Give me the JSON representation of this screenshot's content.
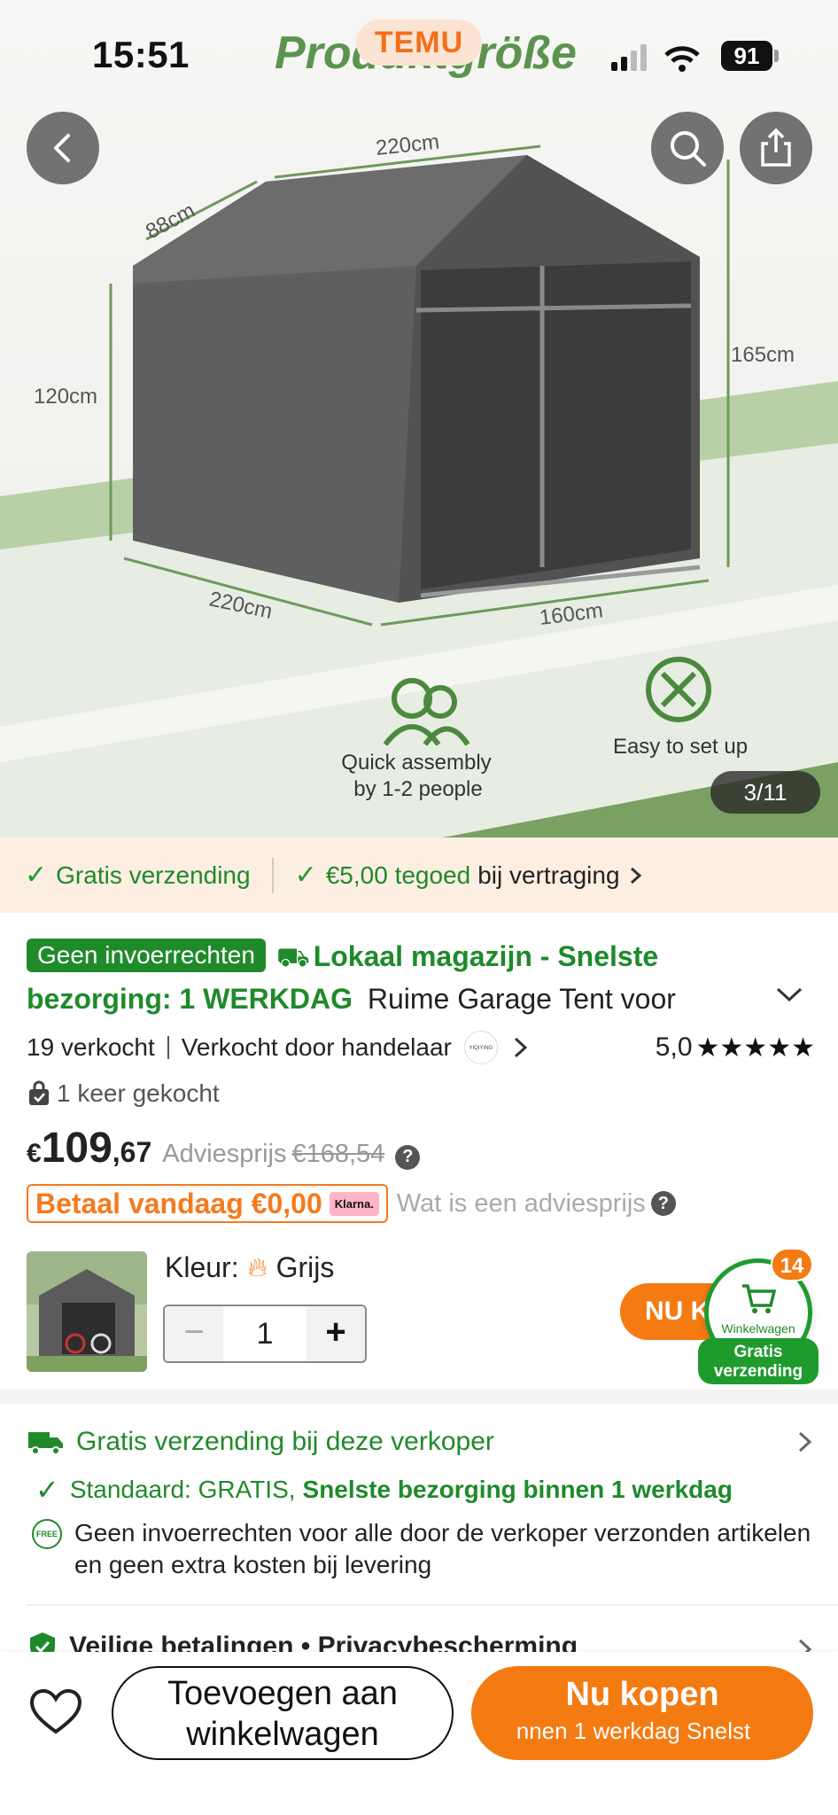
{
  "status": {
    "time": "15:51",
    "battery": "91"
  },
  "hero": {
    "brand": "TEMU",
    "heading": "Produktgröße",
    "dims": {
      "width_top": "220cm",
      "depth": "88cm",
      "side_height": "120cm",
      "height": "165cm",
      "base_left": "220cm",
      "base_front": "160cm"
    },
    "feature1_line1": "Quick assembly",
    "feature1_line2": "by 1-2 people",
    "feature2": "Easy to set up",
    "counter": "3/11"
  },
  "banner": {
    "free_shipping": "Gratis verzending",
    "credit_amount": "€5,00 tegoed",
    "credit_suffix": "bij vertraging"
  },
  "product": {
    "badge": "Geen invoerrechten",
    "title_green": "Lokaal magazijn - Snelste bezorging: 1 WERKDAG",
    "title": "Ruime Garage Tent voor",
    "sold": "19 verkocht",
    "seller": "Verkocht door handelaar",
    "seller_logo": "YIQIYING CO LTD",
    "rating": "5,0",
    "stars": "★★★★★",
    "bought": "1 keer gekocht",
    "currency": "€",
    "price_main": "109",
    "price_cents": ",67",
    "advies_label": "Adviesprijs",
    "advies_price": "€168,54",
    "pay_today": "Betaal vandaag €0,00",
    "klarna": "Klarna.",
    "advies_question": "Wat is een adviesprijs",
    "color_label": "Kleur:",
    "color_value": "Grijs",
    "quantity": "1"
  },
  "cart_float": {
    "buy_small": "NU K",
    "label": "Winkelwagen",
    "count": "14",
    "gratis_line1": "Gratis",
    "gratis_line2": "verzending"
  },
  "shipping": {
    "heading": "Gratis verzending bij deze verkoper",
    "standard_prefix": "Standaard: GRATIS,",
    "standard_bold": "Snelste bezorging binnen 1 werkdag",
    "free_icon": "FREE",
    "no_duties": "Geen invoerrechten voor alle door de verkoper verzonden artikelen en geen extra kosten bij levering",
    "secure": "Veilige betalingen • Privacybescherming"
  },
  "bottom": {
    "add_to_cart_line1": "Toevoegen aan",
    "add_to_cart_line2": "winkelwagen",
    "buy_now": "Nu kopen",
    "buy_now_sub": "nnen 1 werkdag    Snelst"
  },
  "colors": {
    "accent_orange": "#f47a12",
    "green": "#1f8a2a",
    "banner_bg": "#fdeee2"
  }
}
